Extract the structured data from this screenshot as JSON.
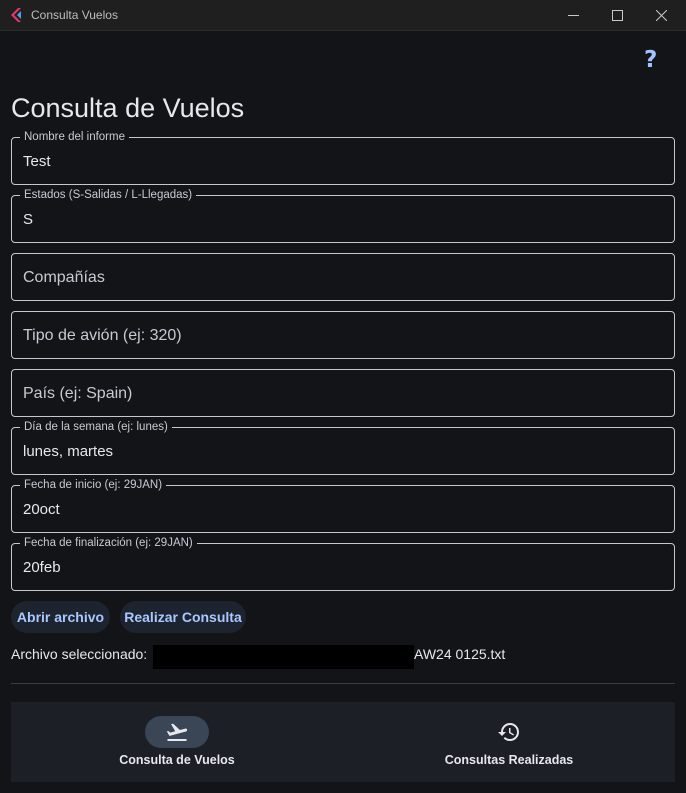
{
  "window": {
    "title": "Consulta Vuelos"
  },
  "header": {
    "help_icon": "?",
    "title": "Consulta de Vuelos"
  },
  "form": {
    "report_name": {
      "label": "Nombre del informe",
      "value": "Test"
    },
    "states": {
      "label": "Estados (S-Salidas / L-Llegadas)",
      "value": "S"
    },
    "companies": {
      "placeholder": "Compañías"
    },
    "aircraft_type": {
      "placeholder": "Tipo de avión (ej: 320)"
    },
    "country": {
      "placeholder": "País (ej: Spain)"
    },
    "weekday": {
      "label": "Día de la semana (ej: lunes)",
      "value": "lunes, martes"
    },
    "start_date": {
      "label": "Fecha de inicio (ej: 29JAN)",
      "value": "20oct"
    },
    "end_date": {
      "label": "Fecha de finalización (ej: 29JAN)",
      "value": "20feb"
    }
  },
  "actions": {
    "open_file": "Abrir archivo",
    "run_query": "Realizar Consulta"
  },
  "file": {
    "label": "Archivo seleccionado:",
    "name_suffix": "AW24 0125.txt"
  },
  "nav": {
    "items": [
      {
        "label": "Consulta de Vuelos",
        "icon": "flight-takeoff-icon",
        "selected": true
      },
      {
        "label": "Consultas Realizadas",
        "icon": "history-icon",
        "selected": false
      }
    ]
  },
  "colors": {
    "accent": "#a8c8ff",
    "background": "#121418",
    "nav_selected": "#3a4556",
    "logo_pink": "#e8336f",
    "logo_blue": "#4aa3f0"
  }
}
